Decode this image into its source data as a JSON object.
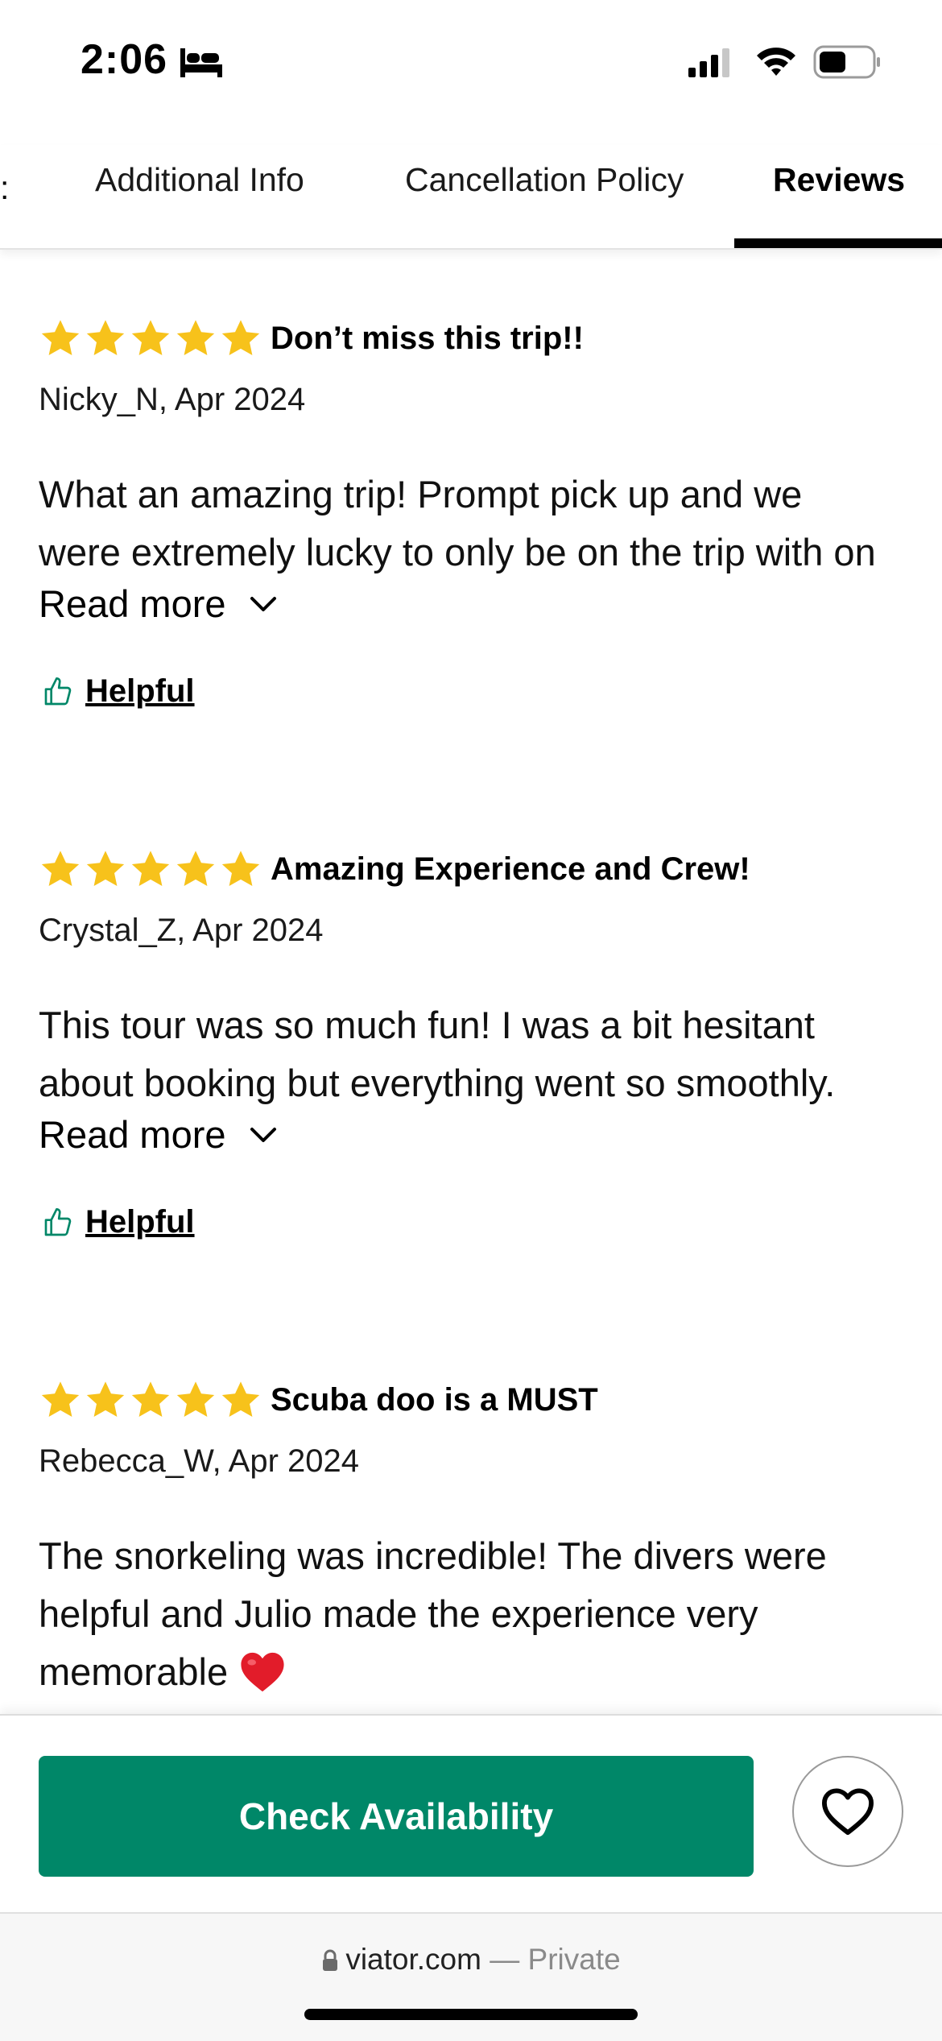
{
  "status_bar": {
    "time": "2:06"
  },
  "tabs": [
    {
      "label": "Additional Info"
    },
    {
      "label": "Cancellation Policy"
    },
    {
      "label": "Reviews",
      "active": true
    }
  ],
  "reviews": [
    {
      "rating": 5,
      "title": "Don’t miss this trip!!",
      "meta": "Nicky_N, Apr 2024",
      "body_lines": [
        "What an amazing trip! Prompt pick up and we",
        "were extremely lucky to only be on the trip with on"
      ],
      "read_more": "Read more",
      "helpful": "Helpful"
    },
    {
      "rating": 5,
      "title": "Amazing Experience and Crew!",
      "meta": "Crystal_Z, Apr 2024",
      "body_lines": [
        "This tour was so much fun! I was a bit hesitant",
        "about booking but everything went so smoothly."
      ],
      "read_more": "Read more",
      "helpful": "Helpful"
    },
    {
      "rating": 5,
      "title": "Scuba doo is a MUST",
      "meta": "Rebecca_W, Apr 2024",
      "body_lines": [
        "The snorkeling was incredible! The divers were",
        "helpful and Julio made the experience very",
        "memorable"
      ],
      "emoji": "heart-emoji"
    }
  ],
  "cta": {
    "label": "Check Availability",
    "color": "#008768"
  },
  "browser": {
    "domain": "viator.com",
    "separator": " — ",
    "mode": "Private"
  },
  "colors": {
    "star": "#F7C21B",
    "accent": "#008768"
  },
  "icons": [
    "bed-icon",
    "signal-icon",
    "wifi-icon",
    "battery-icon",
    "star-icon",
    "chevron-down-icon",
    "thumbs-up-icon",
    "heart-icon",
    "lock-icon"
  ]
}
